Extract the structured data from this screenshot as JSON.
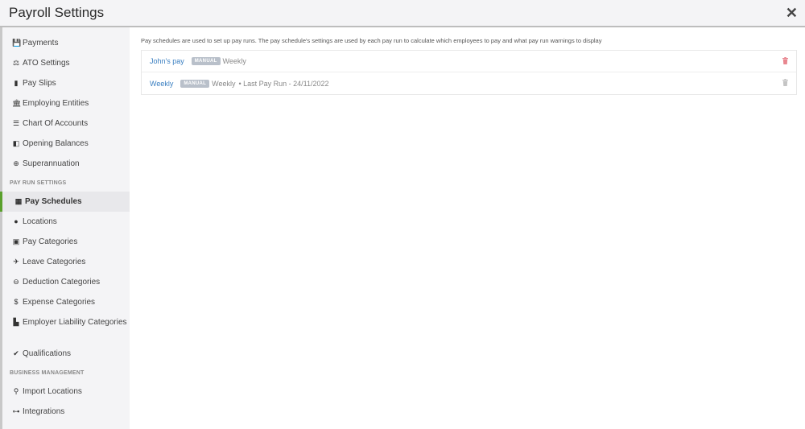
{
  "header": {
    "title": "Payroll Settings",
    "close_icon": "close-icon"
  },
  "sidebar": {
    "items_top": [
      {
        "label": "Payments",
        "icon": "floppy-disk-icon",
        "glyph": "💾"
      },
      {
        "label": "ATO Settings",
        "icon": "scales-icon",
        "glyph": "⚖"
      },
      {
        "label": "Pay Slips",
        "icon": "file-icon",
        "glyph": "▮"
      },
      {
        "label": "Employing Entities",
        "icon": "bank-icon",
        "glyph": "🏛"
      },
      {
        "label": "Chart Of Accounts",
        "icon": "list-icon",
        "glyph": "☰"
      },
      {
        "label": "Opening Balances",
        "icon": "wallet-icon",
        "glyph": "◧"
      },
      {
        "label": "Superannuation",
        "icon": "life-ring-icon",
        "glyph": "⊕"
      }
    ],
    "section_pay_run": "PAY RUN SETTINGS",
    "items_pay_run": [
      {
        "label": "Pay Schedules",
        "icon": "calendar-icon",
        "glyph": "▦",
        "active": true
      },
      {
        "label": "Locations",
        "icon": "globe-icon",
        "glyph": "●"
      },
      {
        "label": "Pay Categories",
        "icon": "money-icon",
        "glyph": "▣"
      },
      {
        "label": "Leave Categories",
        "icon": "plane-icon",
        "glyph": "✈"
      },
      {
        "label": "Deduction Categories",
        "icon": "minus-circle-icon",
        "glyph": "⊖"
      },
      {
        "label": "Expense Categories",
        "icon": "dollar-icon",
        "glyph": "$"
      },
      {
        "label": "Employer Liability Categories",
        "icon": "industry-icon",
        "glyph": "▙"
      },
      {
        "label": "Qualifications",
        "icon": "check-icon",
        "glyph": "✔"
      }
    ],
    "section_business": "BUSINESS MANAGEMENT",
    "items_business": [
      {
        "label": "Import Locations",
        "icon": "map-pin-icon",
        "glyph": "⚲"
      },
      {
        "label": "Integrations",
        "icon": "sitemap-icon",
        "glyph": "⊶"
      }
    ]
  },
  "main": {
    "description": "Pay schedules are used to set up pay runs. The pay schedule's settings are used by each pay run to calculate which employees to pay and what pay run warnings to display",
    "schedules": [
      {
        "name": "John's pay",
        "badge": "MANUAL",
        "frequency": "Weekly",
        "last_run": "",
        "trash_color": "#e8868f"
      },
      {
        "name": "Weekly",
        "badge": "MANUAL",
        "frequency": "Weekly",
        "last_run": "• Last Pay Run - 24/11/2022",
        "trash_color": "#c4c4c4"
      }
    ]
  }
}
